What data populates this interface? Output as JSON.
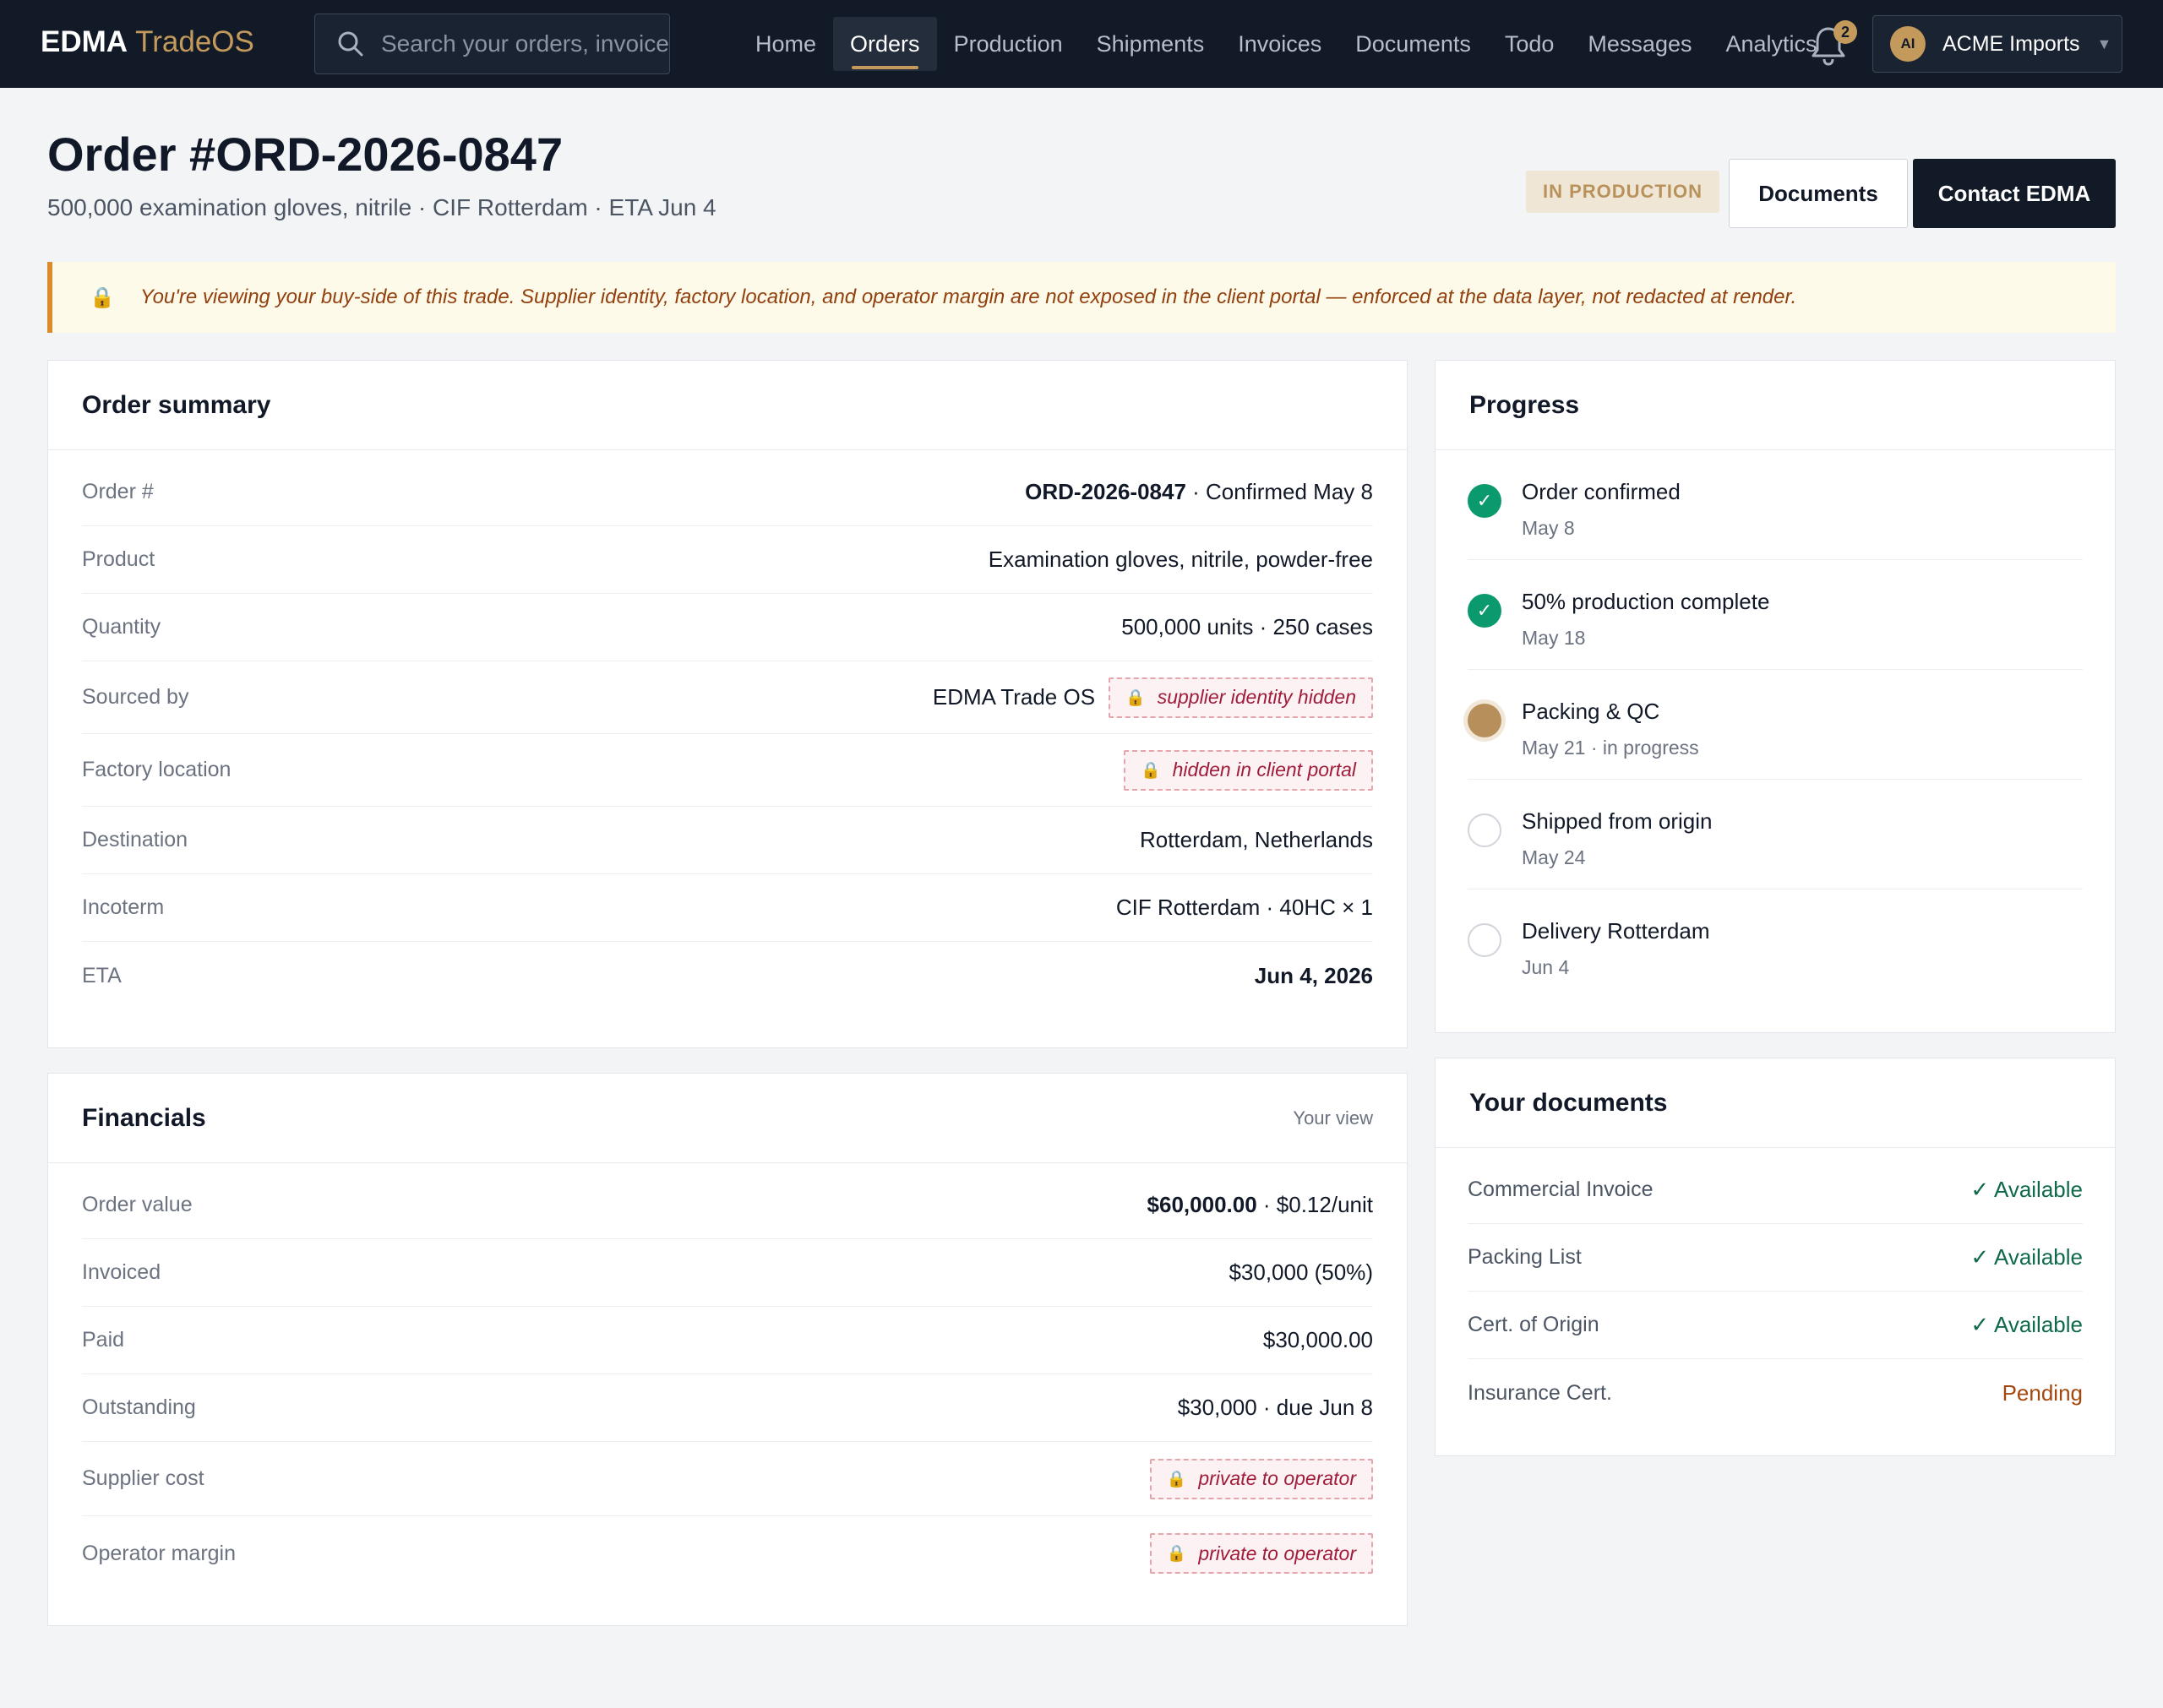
{
  "brand": {
    "name_bold": "EDMA",
    "name_light": "TradeOS"
  },
  "search": {
    "placeholder": "Search your orders, invoices"
  },
  "nav": {
    "items": [
      {
        "label": "Home",
        "active": false
      },
      {
        "label": "Orders",
        "active": true
      },
      {
        "label": "Production",
        "active": false
      },
      {
        "label": "Shipments",
        "active": false
      },
      {
        "label": "Invoices",
        "active": false
      },
      {
        "label": "Documents",
        "active": false
      },
      {
        "label": "Todo",
        "active": false
      },
      {
        "label": "Messages",
        "active": false
      },
      {
        "label": "Analytics",
        "active": false
      }
    ]
  },
  "notifications": {
    "count": "2"
  },
  "account": {
    "initials": "AI",
    "name": "ACME Imports",
    "caret": "▼"
  },
  "header": {
    "title": "Order #ORD-2026-0847",
    "subtitle": "500,000 examination gloves, nitrile · CIF Rotterdam · ETA Jun 4",
    "status": "IN PRODUCTION",
    "documents_button": "Documents",
    "contact_button": "Contact EDMA"
  },
  "notice": {
    "icon": "lock-icon",
    "text": "You're viewing your buy-side of this trade. Supplier identity, factory location, and operator margin are not exposed in the client portal — enforced at the data layer, not redacted at render."
  },
  "summary": {
    "title": "Order summary",
    "order_label": "Order #",
    "order_number": "ORD-2026-0847",
    "order_rest": " · Confirmed May 8",
    "product_label": "Product",
    "product_value": "Examination gloves, nitrile, powder-free",
    "quantity_label": "Quantity",
    "quantity_value": "500,000 units · 250 cases",
    "sourced_label": "Sourced by",
    "sourced_value": "EDMA Trade OS",
    "sourced_tag": "supplier identity hidden",
    "factory_label": "Factory location",
    "factory_tag": "hidden in client portal",
    "destination_label": "Destination",
    "destination_value": "Rotterdam, Netherlands",
    "incoterm_label": "Incoterm",
    "incoterm_value": "CIF Rotterdam · 40HC × 1",
    "eta_label": "ETA",
    "eta_value": "Jun 4, 2026"
  },
  "financials": {
    "title": "Financials",
    "meta": "Your view",
    "order_value_label": "Order value",
    "order_value_amount": "$60,000.00",
    "order_value_rest": " · $0.12/unit",
    "invoiced_label": "Invoiced",
    "invoiced_value": "$30,000 (50%)",
    "paid_label": "Paid",
    "paid_value": "$30,000.00",
    "outstanding_label": "Outstanding",
    "outstanding_value": "$30,000 · due Jun 8",
    "supplier_cost_label": "Supplier cost",
    "supplier_cost_tag": "private to operator",
    "margin_label": "Operator margin",
    "margin_tag": "private to operator"
  },
  "progress": {
    "title": "Progress",
    "check": "✓",
    "steps": [
      {
        "title": "Order confirmed",
        "date": "May 8",
        "state": "done"
      },
      {
        "title": "50% production complete",
        "date": "May 18",
        "state": "done"
      },
      {
        "title": "Packing & QC",
        "date": "May 21 · in progress",
        "state": "current"
      },
      {
        "title": "Shipped from origin",
        "date": "May 24",
        "state": "todo"
      },
      {
        "title": "Delivery Rotterdam",
        "date": "Jun 4",
        "state": "todo"
      }
    ]
  },
  "documents": {
    "title": "Your documents",
    "items": [
      {
        "name": "Commercial Invoice",
        "status": "✓ Available",
        "state": "ok"
      },
      {
        "name": "Packing List",
        "status": "✓ Available",
        "state": "ok"
      },
      {
        "name": "Cert. of Origin",
        "status": "✓ Available",
        "state": "ok"
      },
      {
        "name": "Insurance Cert.",
        "status": "Pending",
        "state": "pending"
      }
    ]
  },
  "colors": {
    "topbar": "#111a26",
    "accent": "#c49a5c",
    "done": "#0b9a6d",
    "pending": "#a4470e",
    "hidden_tag": "#9f1d3a"
  }
}
